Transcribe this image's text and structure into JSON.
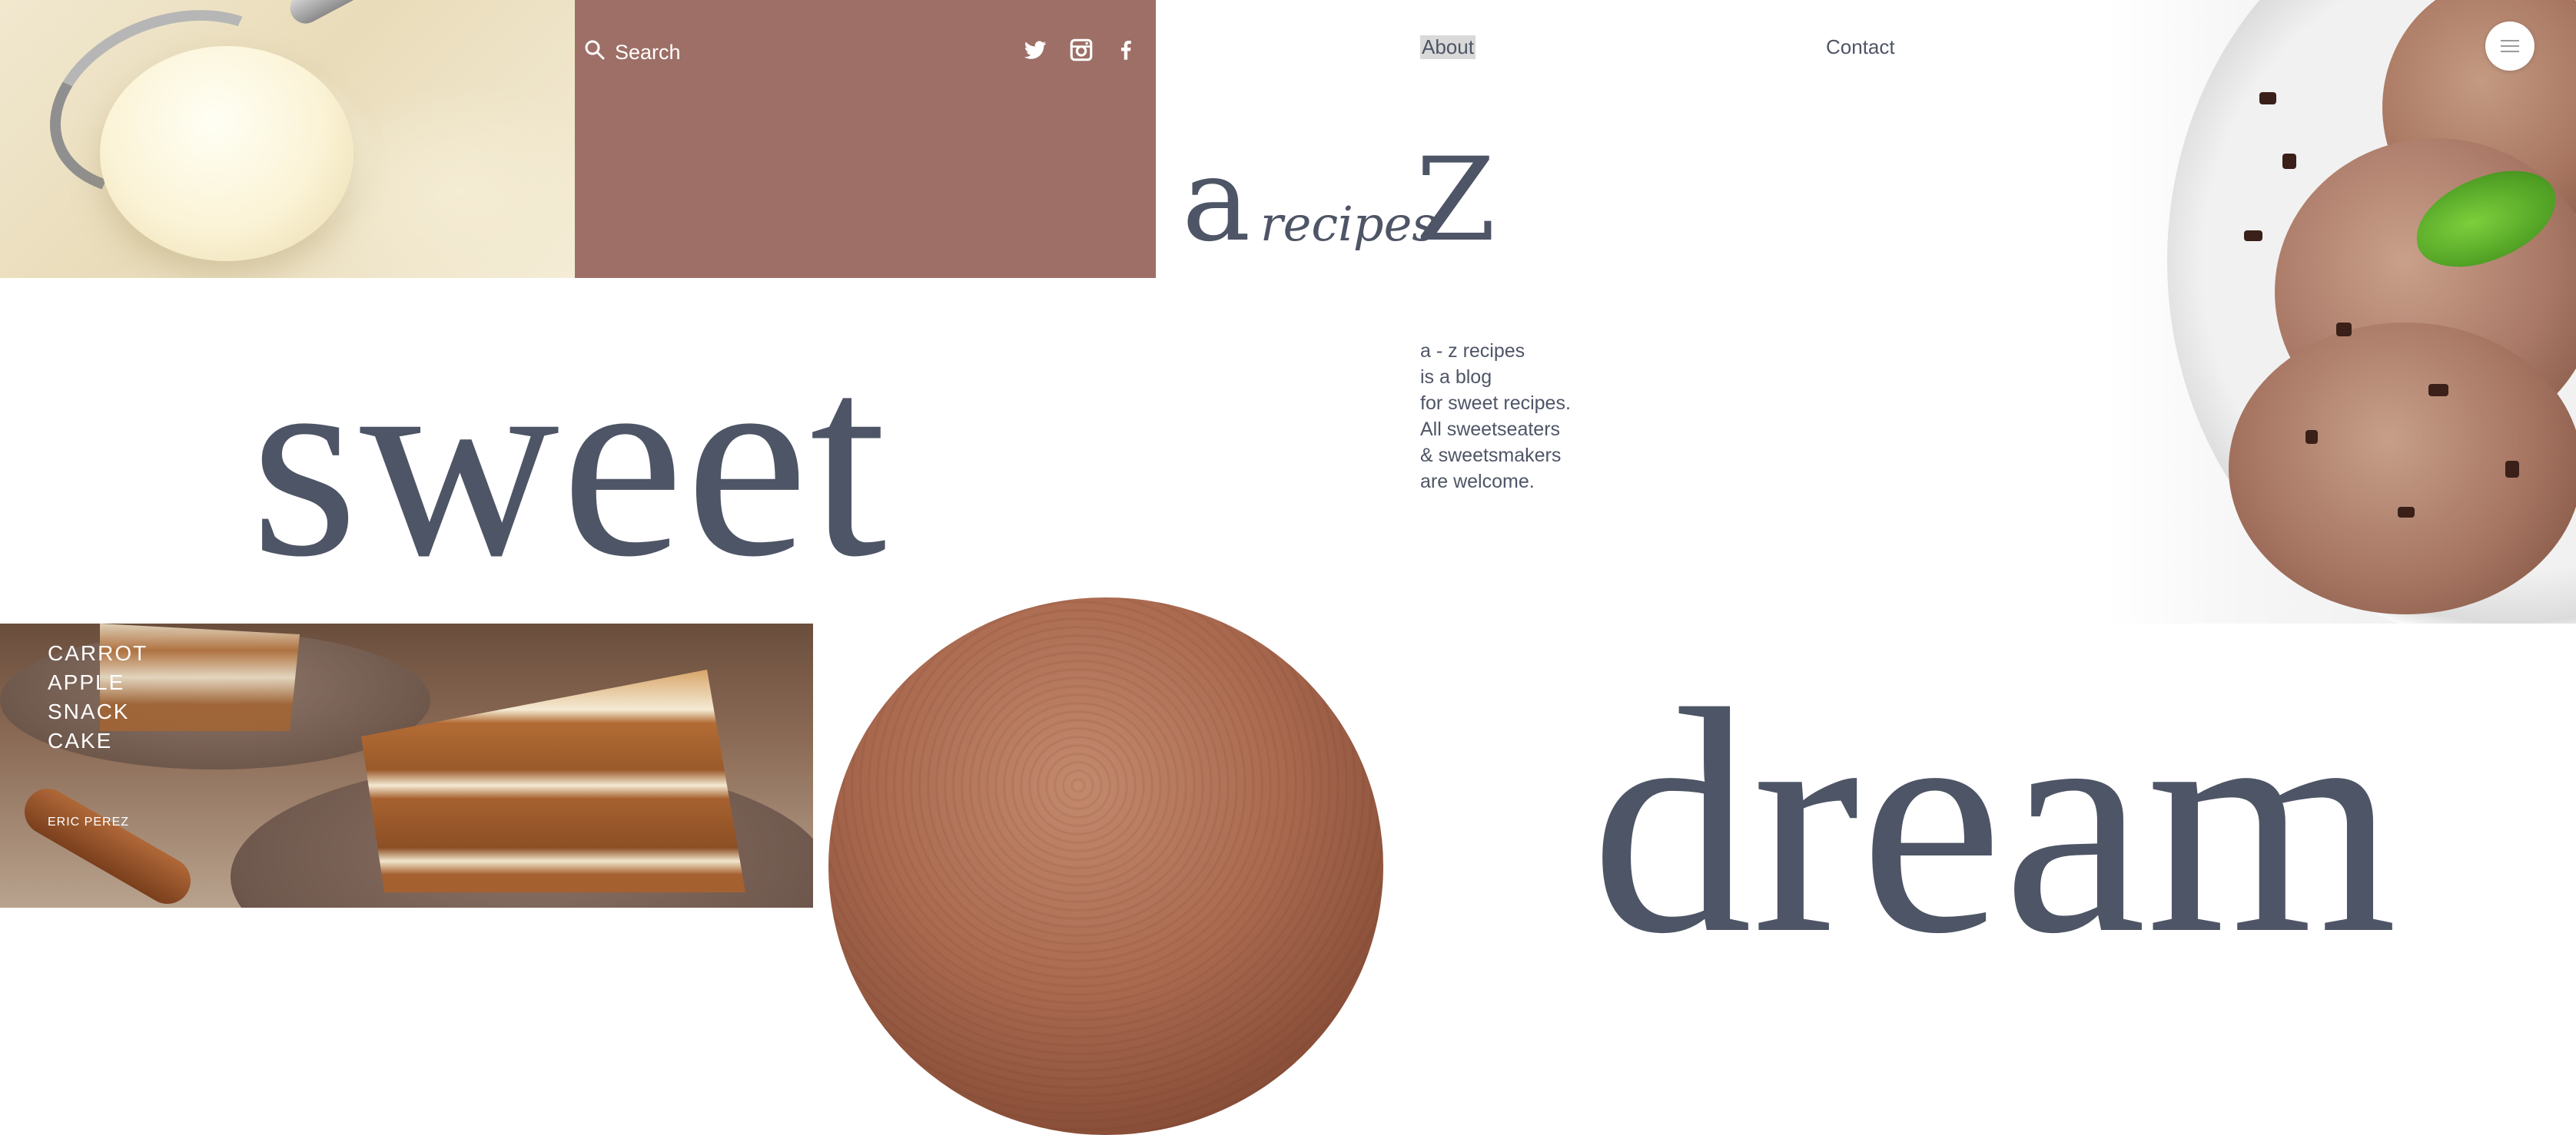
{
  "header": {
    "search_label": "Search",
    "nav": [
      {
        "label": "About"
      },
      {
        "label": "Contact"
      }
    ],
    "social": [
      "twitter-icon",
      "instagram-icon",
      "facebook-icon"
    ]
  },
  "logo": {
    "left": "a",
    "middle": "recipes",
    "right": "z"
  },
  "description": {
    "lines": [
      "a - z recipes",
      "is a blog",
      "for sweet recipes.",
      "All sweetseaters",
      "& sweetsmakers",
      "are welcome."
    ]
  },
  "hero": {
    "word_1": "sweet",
    "word_2": "dream"
  },
  "featured_recipe": {
    "name_lines": [
      "CARROT",
      "APPLE",
      "SNACK",
      "CAKE"
    ],
    "author": "ERIC PEREZ"
  },
  "colors": {
    "panel": "#9d6f66",
    "text": "#4e5566",
    "nav_highlight": "#d9d9d9"
  }
}
